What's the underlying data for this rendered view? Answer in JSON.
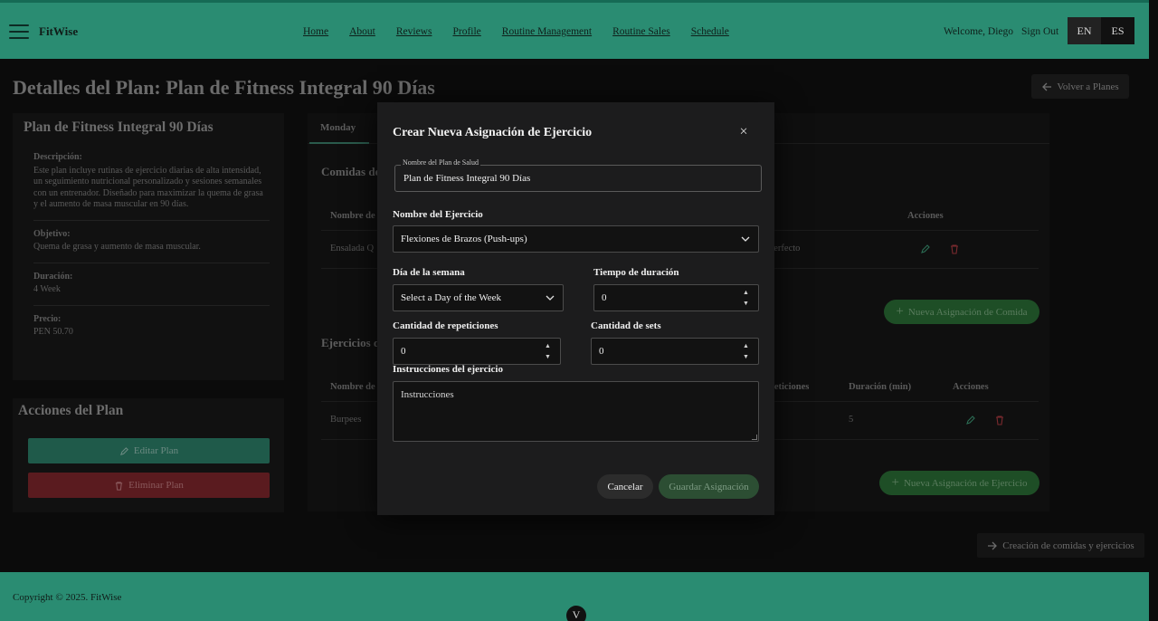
{
  "header": {
    "brand": "FitWise",
    "nav": [
      "Home",
      "About",
      "Reviews",
      "Profile",
      "Routine Management",
      "Routine Sales",
      "Schedule"
    ],
    "welcome": "Welcome, Diego",
    "sign_out": "Sign Out",
    "lang_en": "EN",
    "lang_es": "ES"
  },
  "page": {
    "title": "Detalles del Plan: Plan de Fitness Integral 90 Días",
    "back_label": "Volver a Planes",
    "plan_name": "Plan de Fitness Integral 90 Días",
    "description_label": "Descripción:",
    "description": "Este plan incluye rutinas de ejercicio diarias de alta intensidad, un seguimiento nutricional personalizado y sesiones semanales con un entrenador. Diseñado para maximizar la quema de grasa y el aumento de masa muscular en 90 días.",
    "objective_label": "Objetivo:",
    "objective": "Quema de grasa y aumento de masa muscular.",
    "duration_label": "Duración:",
    "duration": "4 Week",
    "price_label": "Precio:",
    "price": "PEN 50.70",
    "actions_title": "Acciones del Plan",
    "edit_label": "Editar Plan",
    "delete_label": "Eliminar Plan",
    "tab_monday": "Monday",
    "meals_title": "Comidas de",
    "meals_col_name": "Nombre de",
    "meals_col_actions": "Acciones",
    "meal_row_name": "Ensalada Q",
    "meal_row_note": "perfecto",
    "new_meal_label": "Nueva Asignación de Comida",
    "exercises_title": "Ejercicios d",
    "ex_col_name": "Nombre de",
    "ex_col_reps": "peticiones",
    "ex_col_duration": "Duración (min)",
    "ex_col_actions": "Acciones",
    "ex_row_name": "Burpees",
    "ex_row_duration": "5",
    "new_exercise_label": "Nueva Asignación de Ejercicio",
    "creation_label": "Creación de comidas y ejercicios"
  },
  "footer": {
    "copyright": "Copyright © 2025. FitWise",
    "scroll_icon": "V"
  },
  "modal": {
    "title": "Crear Nueva Asignación de Ejercicio",
    "close": "×",
    "plan_field_label": "Nombre del Plan de Salud",
    "plan_field_value": "Plan de Fitness Integral 90 Días",
    "exercise_label": "Nombre del Ejercicio",
    "exercise_value": "Flexiones de Brazos (Push-ups)",
    "day_label": "Día de la semana",
    "day_value": "Select a Day of the Week",
    "time_label": "Tiempo de duración",
    "time_value": "0",
    "reps_label": "Cantidad de repeticiones",
    "reps_value": "0",
    "sets_label": "Cantidad de sets",
    "sets_value": "0",
    "instructions_label": "Instrucciones del ejercicio",
    "instructions_placeholder": "Instrucciones",
    "cancel_label": "Cancelar",
    "save_label": "Guardar Asignación"
  },
  "colors": {
    "header_bg": "#2a8c72",
    "modal_bg": "#1c1c1d",
    "accent_green": "#2c4e33"
  }
}
